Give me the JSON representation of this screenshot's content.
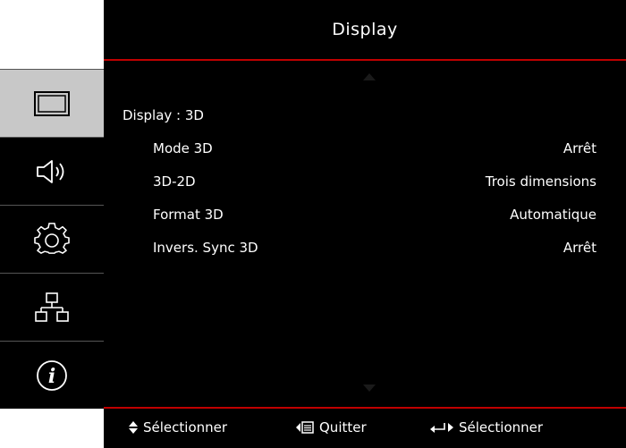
{
  "header": {
    "title": "Display"
  },
  "sidebar": {
    "items": [
      {
        "icon": "display-icon",
        "active": true
      },
      {
        "icon": "speaker-icon",
        "active": false
      },
      {
        "icon": "gear-icon",
        "active": false
      },
      {
        "icon": "network-icon",
        "active": false
      },
      {
        "icon": "info-icon",
        "active": false
      }
    ]
  },
  "menu": {
    "section_title": "Display : 3D",
    "rows": [
      {
        "label": "Mode 3D",
        "value": "Arrêt"
      },
      {
        "label": "3D-2D",
        "value": "Trois dimensions"
      },
      {
        "label": "Format 3D",
        "value": "Automatique"
      },
      {
        "label": "Invers. Sync 3D",
        "value": "Arrêt"
      }
    ]
  },
  "footer": {
    "select_label": "Sélectionner",
    "quit_label": "Quitter",
    "enter_label": "Sélectionner"
  },
  "colors": {
    "accent": "#c00000",
    "background": "#000000",
    "active_tab": "#c8c8c8"
  }
}
